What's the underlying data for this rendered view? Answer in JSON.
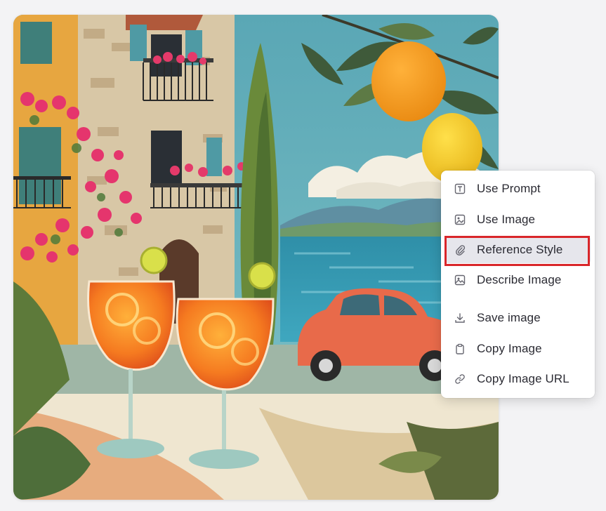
{
  "image": {
    "alt": ""
  },
  "context_menu": {
    "items": [
      {
        "label": "Use Prompt",
        "icon": "text-box-icon"
      },
      {
        "label": "Use Image",
        "icon": "image-edit-icon"
      },
      {
        "label": "Reference Style",
        "icon": "paperclip-icon"
      },
      {
        "label": "Describe Image",
        "icon": "image-icon"
      },
      {
        "label": "Save image",
        "icon": "download-icon"
      },
      {
        "label": "Copy Image",
        "icon": "clipboard-icon"
      },
      {
        "label": "Copy Image URL",
        "icon": "link-icon"
      }
    ]
  },
  "colors": {
    "highlight": "#d9262a",
    "menu_hover": "#e6e6ec",
    "icon": "#666670"
  }
}
